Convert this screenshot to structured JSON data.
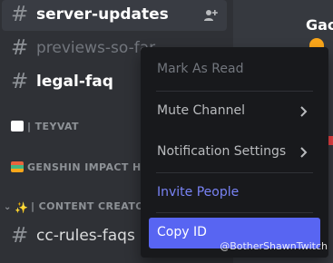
{
  "channels": [
    {
      "name": "server-updates",
      "state": "unread"
    },
    {
      "name": "previews-so-far",
      "state": "muted"
    },
    {
      "name": "legal-faq",
      "state": "unread"
    },
    {
      "name": "cc-rules-faqs",
      "state": "normal"
    }
  ],
  "categories": [
    {
      "label": "| TEYVAT",
      "icon": "speech-bubble-icon"
    },
    {
      "label": "GENSHIN IMPACT HE",
      "icon": "books-icon"
    },
    {
      "label": "| CONTENT CREATOR",
      "icon": "sparkles-icon"
    }
  ],
  "chat": {
    "title_fragment": "Gach"
  },
  "context_menu": {
    "items": [
      {
        "label": "Mark As Read",
        "state": "disabled"
      },
      {
        "label": "Mute Channel",
        "state": "normal",
        "has_submenu": true
      },
      {
        "label": "Notification Settings",
        "state": "normal",
        "has_submenu": true
      },
      {
        "label": "Invite People",
        "state": "brand"
      },
      {
        "label": "Copy ID",
        "state": "active"
      }
    ]
  },
  "watermark": "@BotherShawnTwitch",
  "colors": {
    "accent": "#5865f2",
    "brand_text": "#7983f5",
    "menu_bg": "#18191c",
    "sidebar_bg": "#2f3136"
  }
}
